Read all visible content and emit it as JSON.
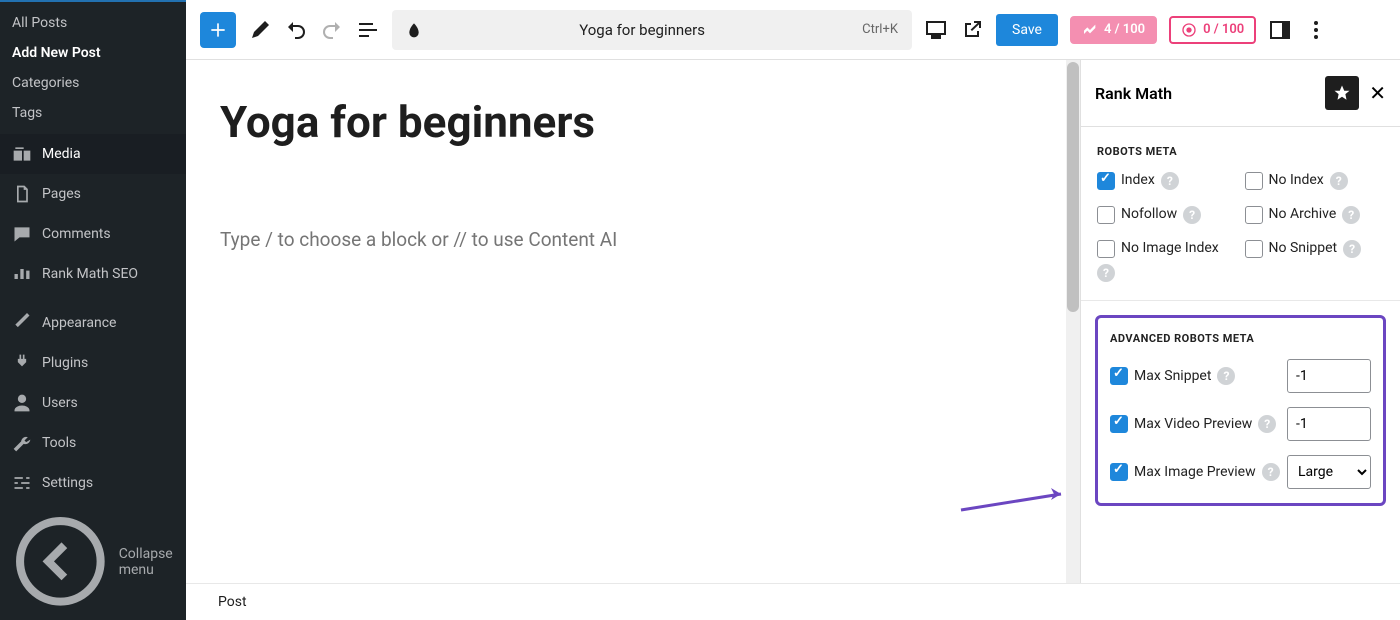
{
  "sidebar": {
    "sub": [
      "All Posts",
      "Add New Post",
      "Categories",
      "Tags"
    ],
    "active_sub": 1,
    "items": [
      {
        "label": "Media",
        "icon": "media"
      },
      {
        "label": "Pages",
        "icon": "pages"
      },
      {
        "label": "Comments",
        "icon": "comments"
      },
      {
        "label": "Rank Math SEO",
        "icon": "seo"
      }
    ],
    "items2": [
      {
        "label": "Appearance",
        "icon": "brush"
      },
      {
        "label": "Plugins",
        "icon": "plug"
      },
      {
        "label": "Users",
        "icon": "user"
      },
      {
        "label": "Tools",
        "icon": "wrench"
      },
      {
        "label": "Settings",
        "icon": "sliders"
      }
    ],
    "collapse": "Collapse menu"
  },
  "topbar": {
    "doc_title": "Yoga for beginners",
    "shortcut": "Ctrl+K",
    "save": "Save",
    "badge1": "4 / 100",
    "badge2": "0 / 100"
  },
  "content": {
    "heading": "Yoga for beginners",
    "placeholder": "Type / to choose a block or // to use Content AI",
    "footer": "Post"
  },
  "panel": {
    "title": "Rank Math",
    "robots_title": "ROBOTS META",
    "robots": [
      {
        "label": "Index",
        "checked": true,
        "help": true
      },
      {
        "label": "No Index",
        "checked": false,
        "help": true
      },
      {
        "label": "Nofollow",
        "checked": false,
        "help": true
      },
      {
        "label": "No Archive",
        "checked": false,
        "help": true
      },
      {
        "label": "No Image Index",
        "checked": false,
        "help": true
      },
      {
        "label": "No Snippet",
        "checked": false,
        "help": true
      }
    ],
    "adv_title": "ADVANCED ROBOTS META",
    "adv": {
      "snippet": {
        "label": "Max Snippet",
        "value": "-1"
      },
      "video": {
        "label": "Max Video Preview",
        "value": "-1"
      },
      "image": {
        "label": "Max Image Preview",
        "value": "Large"
      }
    }
  }
}
